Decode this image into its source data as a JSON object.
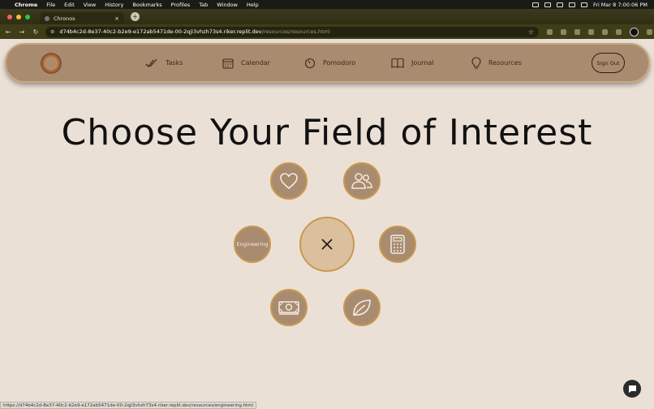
{
  "mac": {
    "menus": [
      "Chrome",
      "File",
      "Edit",
      "View",
      "History",
      "Bookmarks",
      "Profiles",
      "Tab",
      "Window",
      "Help"
    ],
    "datetime": "Fri Mar 8  7:00:06 PM"
  },
  "browser": {
    "tab_title": "Chronos",
    "url_host": "d74b4c2d-8e37-40c2-b2e9-e172ab5471de-00-2qji3vhzh73s4.riker.replit.dev",
    "url_path": "/resources/resources.html",
    "status_url": "https://d74b4c2d-8e37-40c2-b2e9-e172ab5471de-00-2qji3vhzh73s4.riker.replit.dev/resources/engineering.html"
  },
  "nav": {
    "items": [
      {
        "label": "Tasks",
        "icon": "checkmarks-icon"
      },
      {
        "label": "Calendar",
        "icon": "calendar-icon"
      },
      {
        "label": "Pomodoro",
        "icon": "timer-icon"
      },
      {
        "label": "Journal",
        "icon": "book-icon"
      },
      {
        "label": "Resources",
        "icon": "lightbulb-icon"
      }
    ],
    "sign_out": "Sign Out"
  },
  "main": {
    "title": "Choose Your Field of Interest",
    "fields": [
      {
        "label": "",
        "icon": "heart-icon"
      },
      {
        "label": "",
        "icon": "people-icon"
      },
      {
        "label": "Engineering",
        "icon": ""
      },
      {
        "label": "",
        "icon": "close-icon"
      },
      {
        "label": "",
        "icon": "calculator-icon"
      },
      {
        "label": "",
        "icon": "money-icon"
      },
      {
        "label": "",
        "icon": "leaf-icon"
      }
    ]
  },
  "colors": {
    "page_bg": "#ebe0d6",
    "nav_bg": "#a98b6f",
    "circle_bg": "#a98b6f",
    "center_bg": "#dcbf9d",
    "circle_border": "#c9994f"
  }
}
